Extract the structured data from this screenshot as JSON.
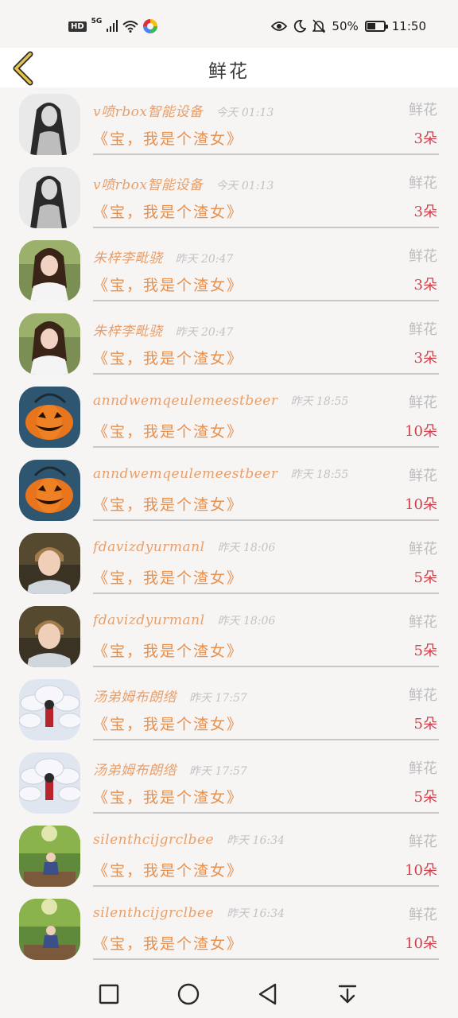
{
  "status_bar": {
    "hd": "HD",
    "network": "5G",
    "battery_text": "50%",
    "battery_level": 0.5,
    "time": "11:50"
  },
  "header": {
    "title": "鲜花"
  },
  "messages": [
    {
      "name": "v喷rbox智能设备",
      "time": "今天 01:13",
      "label": "鲜花",
      "message": "《宝，我是个渣女》",
      "count": "3朵",
      "avatar": "gray-hair-girl"
    },
    {
      "name": "v喷rbox智能设备",
      "time": "今天 01:13",
      "label": "鲜花",
      "message": "《宝，我是个渣女》",
      "count": "3朵",
      "avatar": "gray-hair-girl"
    },
    {
      "name": "朱梓李毗骁",
      "time": "昨天 20:47",
      "label": "鲜花",
      "message": "《宝，我是个渣女》",
      "count": "3朵",
      "avatar": "doll-girl"
    },
    {
      "name": "朱梓李毗骁",
      "time": "昨天 20:47",
      "label": "鲜花",
      "message": "《宝，我是个渣女》",
      "count": "3朵",
      "avatar": "doll-girl"
    },
    {
      "name": "anndwemqeulemeestbeer",
      "time": "昨天 18:55",
      "label": "鲜花",
      "message": "《宝，我是个渣女》",
      "count": "10朵",
      "avatar": "pumpkin"
    },
    {
      "name": "anndwemqeulemeestbeer",
      "time": "昨天 18:55",
      "label": "鲜花",
      "message": "《宝，我是个渣女》",
      "count": "10朵",
      "avatar": "pumpkin"
    },
    {
      "name": "fdavizdyurmanl",
      "time": "昨天 18:06",
      "label": "鲜花",
      "message": "《宝，我是个渣女》",
      "count": "5朵",
      "avatar": "boy"
    },
    {
      "name": "fdavizdyurmanl",
      "time": "昨天 18:06",
      "label": "鲜花",
      "message": "《宝，我是个渣女》",
      "count": "5朵",
      "avatar": "boy"
    },
    {
      "name": "汤弟姆布朗绺",
      "time": "昨天 17:57",
      "label": "鲜花",
      "message": "《宝，我是个渣女》",
      "count": "5朵",
      "avatar": "fox-girl"
    },
    {
      "name": "汤弟姆布朗绺",
      "time": "昨天 17:57",
      "label": "鲜花",
      "message": "《宝，我是个渣女》",
      "count": "5朵",
      "avatar": "fox-girl"
    },
    {
      "name": "silenthcijgrclbee",
      "time": "昨天 16:34",
      "label": "鲜花",
      "message": "《宝，我是个渣女》",
      "count": "10朵",
      "avatar": "forest-boy"
    },
    {
      "name": "silenthcijgrclbee",
      "time": "昨天 16:34",
      "label": "鲜花",
      "message": "《宝，我是个渣女》",
      "count": "10朵",
      "avatar": "forest-boy"
    }
  ],
  "nav": {
    "recent": "square-icon",
    "home": "circle-icon",
    "back": "triangle-back-icon",
    "notifications": "pull-down-icon"
  },
  "colors": {
    "name": "#e8a06a",
    "message": "#e8904c",
    "count": "#d2414b",
    "muted": "#c2c2c2",
    "back_arrow": "#e6c34a"
  }
}
